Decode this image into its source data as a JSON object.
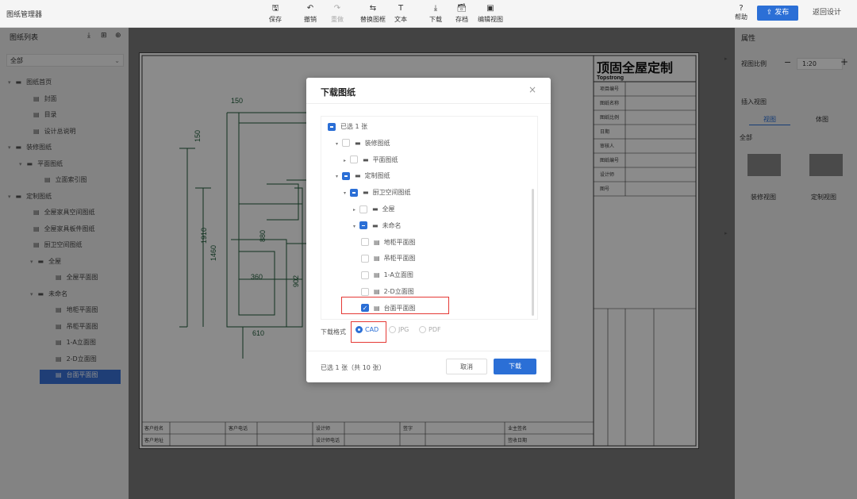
{
  "app": {
    "title": "图纸管理器"
  },
  "toolbar": {
    "save": "保存",
    "undo": "撤销",
    "redo": "重做",
    "replace_frame": "替换图框",
    "text": "文本",
    "download": "下载",
    "archive": "存档",
    "edit_view": "编辑视图",
    "help": "帮助",
    "publish": "发布",
    "back": "返回设计"
  },
  "left_panel": {
    "title": "图纸列表",
    "filter_value": "全部",
    "tree": [
      {
        "label": "图纸首页",
        "level": 0,
        "type": "folder"
      },
      {
        "label": "封面",
        "level": 1,
        "type": "file"
      },
      {
        "label": "目录",
        "level": 1,
        "type": "file"
      },
      {
        "label": "设计总说明",
        "level": 1,
        "type": "file"
      },
      {
        "label": "装修图纸",
        "level": 0,
        "type": "folder"
      },
      {
        "label": "平面图纸",
        "level": 1,
        "type": "folder"
      },
      {
        "label": "立面索引图",
        "level": 2,
        "type": "file"
      },
      {
        "label": "定制图纸",
        "level": 0,
        "type": "folder"
      },
      {
        "label": "全屋家具空间图纸",
        "level": 1,
        "type": "file"
      },
      {
        "label": "全屋家具板件图纸",
        "level": 1,
        "type": "file"
      },
      {
        "label": "厨卫空间图纸",
        "level": 1,
        "type": "file"
      },
      {
        "label": "全屋",
        "level": 2,
        "type": "folder"
      },
      {
        "label": "全屋平面图",
        "level": 3,
        "type": "file"
      },
      {
        "label": "未命名",
        "level": 2,
        "type": "folder"
      },
      {
        "label": "地柜平面图",
        "level": 3,
        "type": "file"
      },
      {
        "label": "吊柜平面图",
        "level": 3,
        "type": "file"
      },
      {
        "label": "1-A立面图",
        "level": 3,
        "type": "file"
      },
      {
        "label": "2-D立面图",
        "level": 3,
        "type": "file"
      },
      {
        "label": "台面平面图",
        "level": 3,
        "type": "file",
        "selected": true
      }
    ]
  },
  "right_panel": {
    "properties": "属性",
    "view_scale_label": "视图比例",
    "view_scale_value": "1:20",
    "insert_view": "插入视图",
    "tab_view": "视图",
    "tab_solid": "体图",
    "all": "全部",
    "thumb_decor": "装修视图",
    "thumb_custom": "定制视图"
  },
  "drawing": {
    "brand_cn": "顶固全屋定制",
    "brand_en": "Topstrong",
    "dims": [
      "150",
      "150",
      "1910",
      "1460",
      "880",
      "360",
      "902",
      "610"
    ],
    "title_rows": [
      "项目编号",
      "图纸名称",
      "图纸比例",
      "日期",
      "审核人",
      "图纸编号",
      "设计师",
      "图号"
    ],
    "footer": [
      "客户姓名",
      "客户电话",
      "设计师",
      "设计师电话",
      "签字",
      "客户地址",
      "业主签名",
      "签收日期"
    ]
  },
  "modal": {
    "title": "下载图纸",
    "close": "×",
    "items": [
      {
        "label": "已选 1 张",
        "level": 0,
        "state": "ind",
        "arrow": ""
      },
      {
        "label": "装修图纸",
        "level": 1,
        "state": "none",
        "arrow": "▾",
        "folder": true
      },
      {
        "label": "平面图纸",
        "level": 2,
        "state": "none",
        "arrow": "▸",
        "folder": true
      },
      {
        "label": "定制图纸",
        "level": 1,
        "state": "ind",
        "arrow": "▾",
        "folder": true
      },
      {
        "label": "厨卫空间图纸",
        "level": 2,
        "state": "ind",
        "arrow": "▾",
        "folder": true
      },
      {
        "label": "全屋",
        "level": 3,
        "state": "none",
        "arrow": "▸",
        "folder": true
      },
      {
        "label": "未命名",
        "level": 3,
        "state": "ind",
        "arrow": "▾",
        "folder": true
      },
      {
        "label": "地柜平面图",
        "level": 4,
        "state": "none",
        "arrow": "",
        "folder": false
      },
      {
        "label": "吊柜平面图",
        "level": 4,
        "state": "none",
        "arrow": "",
        "folder": false
      },
      {
        "label": "1-A立面图",
        "level": 4,
        "state": "none",
        "arrow": "",
        "folder": false
      },
      {
        "label": "2-D立面图",
        "level": 4,
        "state": "none",
        "arrow": "",
        "folder": false
      },
      {
        "label": "台面平面图",
        "level": 4,
        "state": "chk",
        "arrow": "",
        "folder": false
      }
    ],
    "format_label": "下载格式",
    "formats": [
      {
        "label": "CAD",
        "selected": true
      },
      {
        "label": "JPG",
        "selected": false
      },
      {
        "label": "PDF",
        "selected": false
      }
    ],
    "summary": "已选 1 张（共 10 张）",
    "cancel": "取消",
    "download": "下载"
  },
  "colors": {
    "accent": "#2b6fd6",
    "highlight": "#e53935",
    "drawing_line": "#1f5c3a"
  }
}
